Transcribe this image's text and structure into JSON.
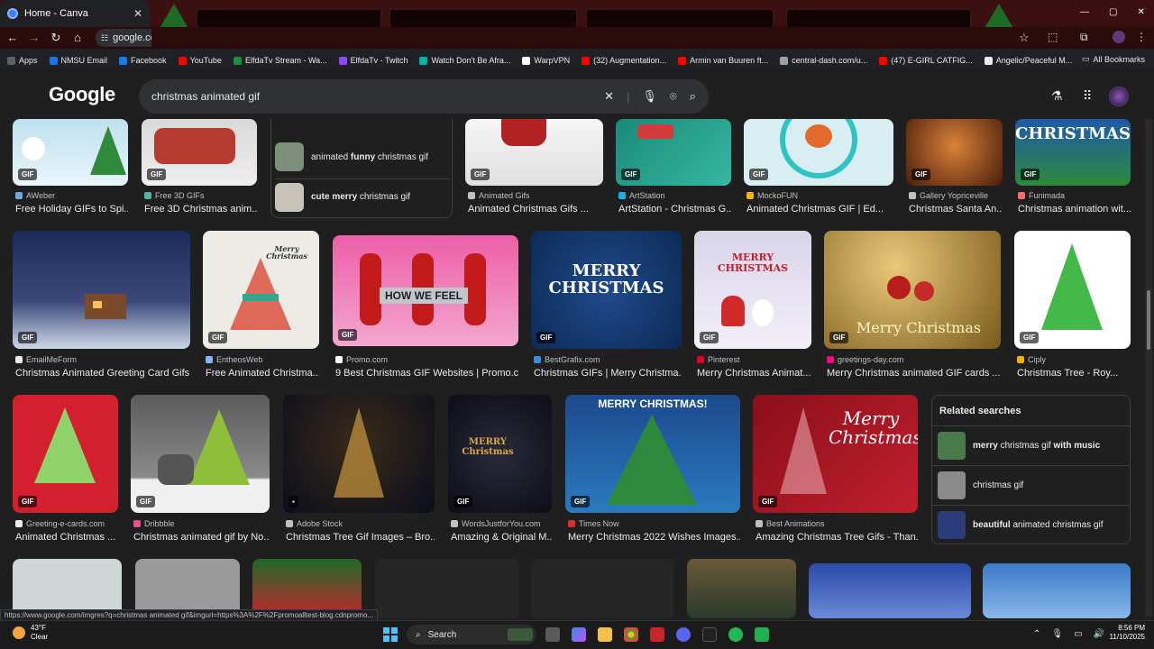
{
  "browser": {
    "tab_title": "Home - Canva",
    "tab_close": "✕",
    "address": "google.co",
    "bookmarks": [
      {
        "label": "Apps",
        "color": "#5f6368"
      },
      {
        "label": "NMSU Email",
        "color": "#1a73e8"
      },
      {
        "label": "Facebook",
        "color": "#1877f2"
      },
      {
        "label": "YouTube",
        "color": "#ff0000"
      },
      {
        "label": "ElfdaTv Stream - Wa...",
        "color": "#1e8e3e"
      },
      {
        "label": "ElfdaTv - Twitch",
        "color": "#9146ff"
      },
      {
        "label": "Watch Don't Be Afra...",
        "color": "#00b2a9"
      },
      {
        "label": "WarpVPN",
        "color": "#ffffff"
      },
      {
        "label": "(32) Augmentation...",
        "color": "#ff0000"
      },
      {
        "label": "Armin van Buuren ft...",
        "color": "#ff0000"
      },
      {
        "label": "central-dash.com/u...",
        "color": "#9aa0a6"
      },
      {
        "label": "(47) E-GIRL CATFIG...",
        "color": "#ff0000"
      },
      {
        "label": "Angelic/Peaceful M...",
        "color": "#e8eaed"
      }
    ],
    "all_bookmarks": "All Bookmarks"
  },
  "google": {
    "logo": "Google",
    "query": "christmas animated gif"
  },
  "suggestions": [
    {
      "pre": "animated ",
      "bold": "funny",
      "post": " christmas gif",
      "color": "#7b8f7a"
    },
    {
      "pre": "",
      "bold": "cute merry",
      "post": " christmas gif",
      "color": "#c8c2b8"
    }
  ],
  "row1": [
    {
      "source": "AWeber",
      "title": "Free Holiday GIFs to Spi...",
      "badge": "GIF",
      "icon": "#6fa8dc"
    },
    {
      "source": "Free 3D GIFs",
      "title": "Free 3D Christmas anim...",
      "badge": "GIF",
      "icon": "#4fb3a5"
    },
    {
      "source": "Animated Gifs",
      "title": "Animated Christmas Gifs ...",
      "badge": "GIF",
      "icon": "#bdc1c6"
    },
    {
      "source": "ArtStation",
      "title": "ArtStation - Christmas G...",
      "badge": "GIF",
      "icon": "#13aff0"
    },
    {
      "source": "MockoFUN",
      "title": "Animated Christmas GIF | Ed...",
      "badge": "GIF",
      "icon": "#f4b400"
    },
    {
      "source": "Gallery Yopriceville",
      "title": "Christmas Santa An...",
      "badge": "GIF",
      "icon": "#bdc1c6"
    },
    {
      "source": "Funimada",
      "title": "Christmas animation wit...",
      "badge": "GIF",
      "icon": "#ff6b6b"
    }
  ],
  "row2": [
    {
      "source": "EmailMeForm",
      "title": "Christmas Animated Greeting Card Gifs",
      "badge": "GIF",
      "icon": "#e8eaed"
    },
    {
      "source": "EntheosWeb",
      "title": "Free Animated Christma...",
      "badge": "GIF",
      "icon": "#8ab4f8"
    },
    {
      "source": "Promo.com",
      "title": "9 Best Christmas GIF Websites | Promo.c...",
      "badge": "GIF",
      "icon": "#ffffff",
      "overlay": "HOW WE FEEL"
    },
    {
      "source": "BestGrafix.com",
      "title": "Christmas GIFs | Merry Christma...",
      "badge": "GIF",
      "icon": "#3c8dde",
      "overlay": "MERRY CHRISTMAS"
    },
    {
      "source": "Pinterest",
      "title": "Merry Christmas Animat...",
      "badge": "GIF",
      "icon": "#e60023",
      "overlay": "MERRY CHRISTMAS"
    },
    {
      "source": "greetings-day.com",
      "title": "Merry Christmas animated GIF cards ...",
      "badge": "GIF",
      "icon": "#ff0080",
      "overlay": "Merry Christmas"
    },
    {
      "source": "Ciply",
      "title": "Christmas Tree - Roy...",
      "badge": "GIF",
      "icon": "#f4b400"
    }
  ],
  "row3": [
    {
      "source": "Greeting-e-cards.com",
      "title": "Animated Christmas ...",
      "badge": "GIF",
      "icon": "#e8eaed"
    },
    {
      "source": "Dribbble",
      "title": "Christmas animated gif by No...",
      "badge": "GIF",
      "icon": "#ea4c89"
    },
    {
      "source": "Adobe Stock",
      "title": "Christmas Tree Gif Images – Bro...",
      "badge": "▪",
      "icon": "#bdc1c6"
    },
    {
      "source": "WordsJustforYou.com",
      "title": "Amazing & Original M...",
      "badge": "GIF",
      "icon": "#bdc1c6",
      "overlay": "MERRY Christmas"
    },
    {
      "source": "Times Now",
      "title": "Merry Christmas 2022 Wishes Images...",
      "badge": "GIF",
      "icon": "#d93025",
      "overlay": "MERRY CHRISTMAS!"
    },
    {
      "source": "Best Animations",
      "title": "Amazing Christmas Tree Gifs - Than...",
      "badge": "GIF",
      "icon": "#bdc1c6",
      "overlay": "Merry Christmas"
    }
  ],
  "related": {
    "title": "Related searches",
    "items": [
      {
        "pre": "",
        "bold": "merry",
        "mid": " christmas gif ",
        "bold2": "with music",
        "color": "#4a7a4a"
      },
      {
        "pre": "christmas gif",
        "bold": "",
        "mid": "",
        "bold2": "",
        "color": "#8a8a8a"
      },
      {
        "pre": "",
        "bold": "beautiful",
        "mid": " animated christmas gif",
        "bold2": "",
        "color": "#2c3c7a"
      }
    ]
  },
  "status_url": "https://www.google.com/imgres?q=christmas animated gif&imgurl=https%3A%2F%2Fpromoalltest-blog.cdnpromo...",
  "taskbar": {
    "temp": "43°F",
    "condition": "Clear",
    "search": "Search",
    "time": "8:56 PM",
    "date": "11/10/2025"
  },
  "colors": {
    "accent": "#8ab4f8",
    "background": "#1f1f1f",
    "text": "#e8eaed"
  }
}
